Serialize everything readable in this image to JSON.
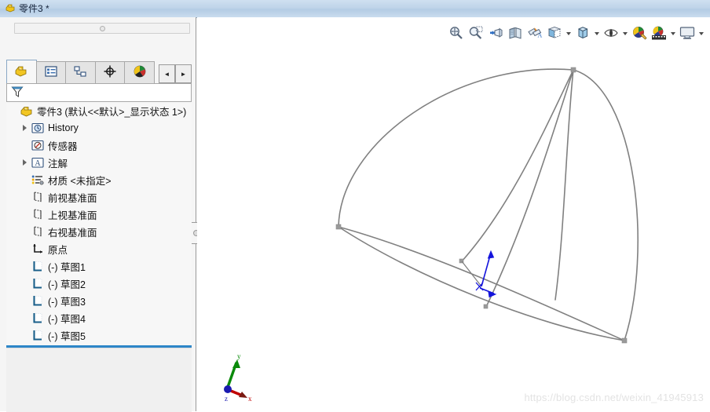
{
  "window": {
    "title": "零件3 *",
    "title_icon": "part-document-icon"
  },
  "left_panel": {
    "tabs": [
      {
        "name": "feature-manager-design-tree",
        "icon": "part-tree-icon",
        "active": true
      },
      {
        "name": "property-manager",
        "icon": "property-list-icon",
        "active": false
      },
      {
        "name": "configuration-manager",
        "icon": "configuration-icon",
        "active": false
      },
      {
        "name": "dimxpert-manager",
        "icon": "crosshair-target-icon",
        "active": false
      },
      {
        "name": "display-manager",
        "icon": "color-sphere-icon",
        "active": false
      }
    ],
    "tab_scroll": {
      "left_label": "◄",
      "right_label": "►"
    },
    "filter": {
      "icon": "filter-funnel-icon",
      "value": "",
      "placeholder": ""
    },
    "tree": [
      {
        "label": "零件3  (默认<<默认>_显示状态 1>)",
        "icon": "part-root-icon",
        "expandable": false,
        "indent": 0
      },
      {
        "label": "History",
        "icon": "history-folder-icon",
        "expandable": true,
        "indent": 1
      },
      {
        "label": "传感器",
        "icon": "sensors-icon",
        "expandable": false,
        "indent": 1
      },
      {
        "label": "注解",
        "icon": "annotations-icon",
        "expandable": true,
        "indent": 1
      },
      {
        "label": "材质 <未指定>",
        "icon": "material-icon",
        "expandable": false,
        "indent": 1
      },
      {
        "label": "前视基准面",
        "icon": "plane-icon",
        "expandable": false,
        "indent": 1
      },
      {
        "label": "上视基准面",
        "icon": "plane-icon",
        "expandable": false,
        "indent": 1
      },
      {
        "label": "右视基准面",
        "icon": "plane-icon",
        "expandable": false,
        "indent": 1
      },
      {
        "label": "原点",
        "icon": "origin-icon",
        "expandable": false,
        "indent": 1
      },
      {
        "label": "(-) 草图1",
        "icon": "sketch-icon",
        "expandable": false,
        "indent": 1
      },
      {
        "label": "(-) 草图2",
        "icon": "sketch-icon",
        "expandable": false,
        "indent": 1
      },
      {
        "label": "(-) 草图3",
        "icon": "sketch-icon",
        "expandable": false,
        "indent": 1
      },
      {
        "label": "(-) 草图4",
        "icon": "sketch-icon",
        "expandable": false,
        "indent": 1
      },
      {
        "label": "(-) 草图5",
        "icon": "sketch-icon",
        "expandable": false,
        "indent": 1
      }
    ],
    "rollback_bar": {
      "name": "rollback-bar",
      "color": "#2e86c8"
    },
    "splitter": {
      "name": "panel-splitter-handle"
    }
  },
  "viewport": {
    "background": "#ffffff",
    "toolbar": [
      {
        "name": "zoom-to-fit-button",
        "icon": "zoom-to-fit-icon",
        "caret": false
      },
      {
        "name": "zoom-to-area-button",
        "icon": "zoom-to-area-icon",
        "caret": false
      },
      {
        "name": "previous-view-button",
        "icon": "previous-view-icon",
        "caret": false
      },
      {
        "name": "section-view-button",
        "icon": "section-view-icon",
        "caret": false
      },
      {
        "name": "view-orientation-button",
        "icon": "dynamic-annotation-icon",
        "caret": false
      },
      {
        "name": "view-orientation-cube-button",
        "icon": "view-orientation-icon",
        "caret": true
      },
      {
        "name": "display-style-button",
        "icon": "display-style-cube-icon",
        "caret": true
      },
      {
        "name": "hide-show-items-button",
        "icon": "hide-show-eye-icon",
        "caret": true
      },
      {
        "name": "edit-appearance-button",
        "icon": "appearance-sphere-icon",
        "caret": false
      },
      {
        "name": "apply-scene-button",
        "icon": "scene-icon",
        "caret": true
      },
      {
        "name": "view-settings-button",
        "icon": "display-monitor-icon",
        "caret": true
      }
    ],
    "watermark": "https://blog.csdn.net/weixin_41945913",
    "triad": {
      "name": "coordinate-triad",
      "x_label": "x",
      "y_label": "y",
      "z_label": "z",
      "x_color": "#c00000",
      "y_color": "#0a8a0a",
      "z_color": "#1a1ab0"
    },
    "model": {
      "name": "dome-wireframe-model",
      "edge_color": "#808080",
      "vertex_color": "#9a9a9a",
      "origin_marker_color": "#1414dc",
      "apex": [
        730,
        89
      ],
      "left_vertex": [
        431,
        289
      ],
      "right_vertex": [
        795,
        434
      ],
      "mid_vertex_a": [
        588,
        333
      ],
      "mid_vertex_b": [
        639,
        391
      ],
      "origin": [
        613,
        365
      ]
    }
  }
}
